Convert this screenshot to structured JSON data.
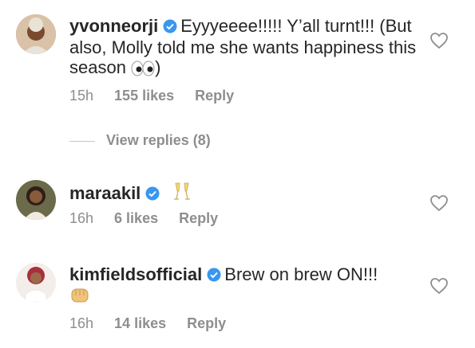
{
  "comments": [
    {
      "username": "yvonneorji",
      "text": "Eyyyeeee!!!!! Y’all turnt!!! (But also, Molly told me she wants happiness this season",
      "text_suffix": ")",
      "emoji": "eyes",
      "time": "15h",
      "likes": "155 likes",
      "reply": "Reply",
      "view_replies": "View replies (8)"
    },
    {
      "username": "maraakil",
      "text": "",
      "emoji": "clinking-glasses",
      "time": "16h",
      "likes": "6 likes",
      "reply": "Reply"
    },
    {
      "username": "kimfieldsofficial",
      "text": "Brew on brew ON!!!",
      "emoji": "oncoming-fist",
      "time": "16h",
      "likes": "14 likes",
      "reply": "Reply"
    }
  ],
  "colors": {
    "text": "#262626",
    "meta": "#8e8e8e",
    "verified": "#3897f0"
  }
}
